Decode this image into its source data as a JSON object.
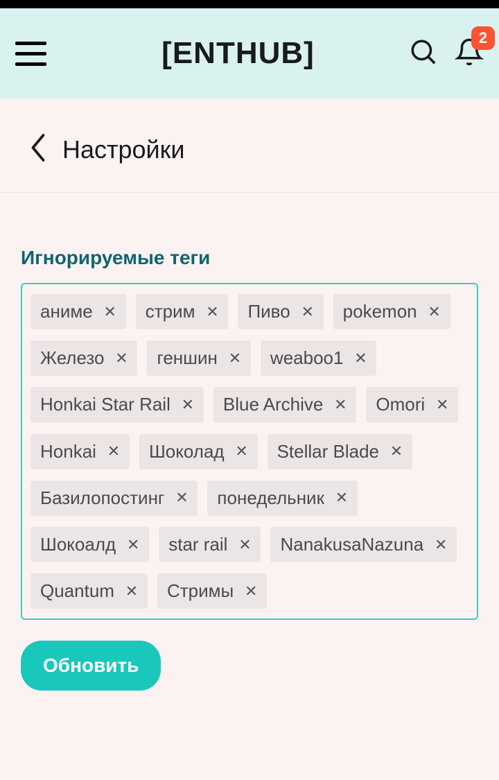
{
  "header": {
    "logo": "[ENTHUB]",
    "notification_count": "2"
  },
  "back": {
    "title": "Настройки"
  },
  "section": {
    "title": "Игнорируемые теги"
  },
  "tags": [
    "аниме",
    "стрим",
    "Пиво",
    "pokemon",
    "Железо",
    "геншин",
    "weaboo1",
    "Honkai Star Rail",
    "Blue Archive",
    "Omori",
    "Honkai",
    "Шоколад",
    "Stellar Blade",
    "Базилопостинг",
    "понедельник",
    "Шокоалд",
    "star rail",
    "NanakusaNazuna",
    "Quantum",
    "Стримы"
  ],
  "update_button": "Обновить"
}
